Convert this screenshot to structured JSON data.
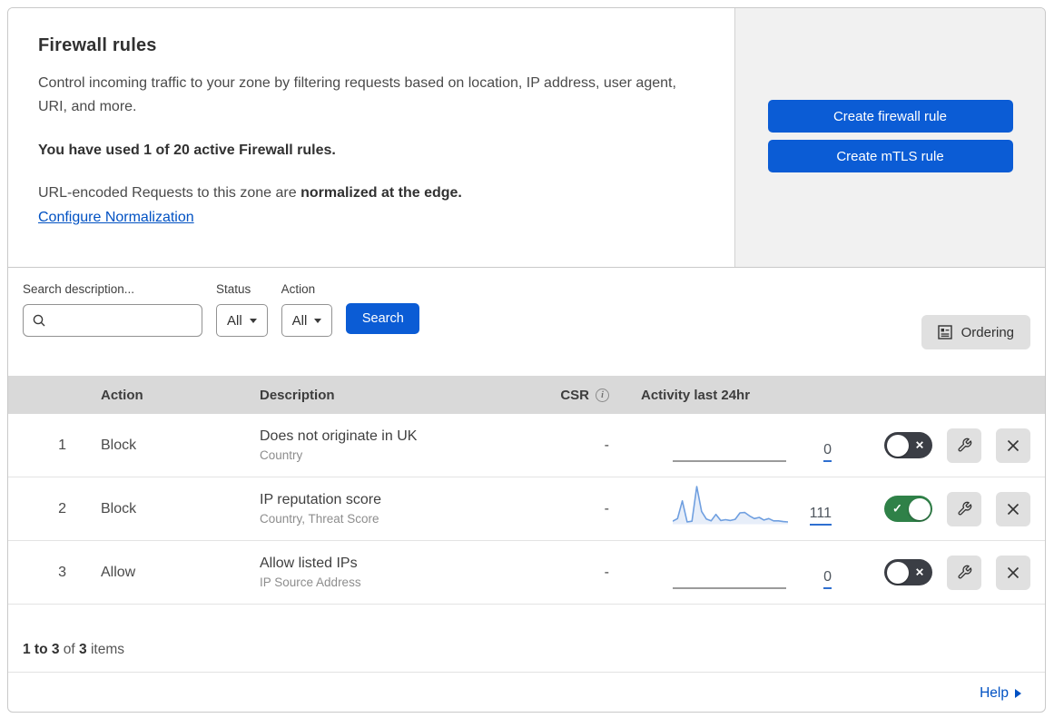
{
  "intro": {
    "title": "Firewall rules",
    "description": "Control incoming traffic to your zone by filtering requests based on location, IP address, user agent, URI, and more.",
    "usage": "You have used 1 of 20 active Firewall rules.",
    "normalization_prefix": "URL-encoded Requests to this zone are ",
    "normalization_bold": "normalized at the edge.",
    "normalization_link": "Configure Normalization"
  },
  "cta": {
    "create_firewall_rule": "Create firewall rule",
    "create_mtls_rule": "Create mTLS rule"
  },
  "filters": {
    "search_label": "Search description...",
    "search_value": "",
    "status_label": "Status",
    "status_value": "All",
    "action_label": "Action",
    "action_value": "All",
    "search_button": "Search",
    "ordering_button": "Ordering"
  },
  "table": {
    "headers": {
      "action": "Action",
      "description": "Description",
      "csr": "CSR",
      "activity": "Activity last 24hr"
    },
    "rows": [
      {
        "number": "1",
        "action": "Block",
        "description": "Does not originate in UK",
        "expression": "Country",
        "csr": "-",
        "count": "0",
        "enabled": false,
        "sparkline": null
      },
      {
        "number": "2",
        "action": "Block",
        "description": "IP reputation score",
        "expression": "Country, Threat Score",
        "csr": "-",
        "count": "111",
        "enabled": true,
        "sparkline": [
          8,
          15,
          62,
          6,
          8,
          100,
          34,
          14,
          9,
          26,
          10,
          12,
          10,
          13,
          30,
          31,
          22,
          15,
          18,
          11,
          15,
          9,
          9,
          7,
          6
        ]
      },
      {
        "number": "3",
        "action": "Allow",
        "description": "Allow listed IPs",
        "expression": "IP Source Address",
        "csr": "-",
        "count": "0",
        "enabled": false,
        "sparkline": null
      }
    ]
  },
  "chart_data": {
    "type": "line",
    "title": "Activity last 24hr (rule 2 sparkline)",
    "x": [
      0,
      1,
      2,
      3,
      4,
      5,
      6,
      7,
      8,
      9,
      10,
      11,
      12,
      13,
      14,
      15,
      16,
      17,
      18,
      19,
      20,
      21,
      22,
      23,
      24
    ],
    "values": [
      8,
      15,
      62,
      6,
      8,
      100,
      34,
      14,
      9,
      26,
      10,
      12,
      10,
      13,
      30,
      31,
      22,
      15,
      18,
      11,
      15,
      9,
      9,
      7,
      6
    ],
    "xlabel": "",
    "ylabel": "",
    "ylim": [
      0,
      100
    ],
    "legend": "none",
    "grid": false
  },
  "footer": {
    "range": "1 to 3",
    "of": " of ",
    "total": "3",
    "items": " items",
    "help": "Help"
  },
  "colors": {
    "primary_blue": "#0b5cd5",
    "link_blue": "#0051c3",
    "toggle_on_green": "#2f8148",
    "toggle_off_gray": "#3b3e45",
    "table_header_gray": "#d9d9d9",
    "panel_gray": "#f1f1f1",
    "sparkline_blue": "#6f9fe0"
  }
}
